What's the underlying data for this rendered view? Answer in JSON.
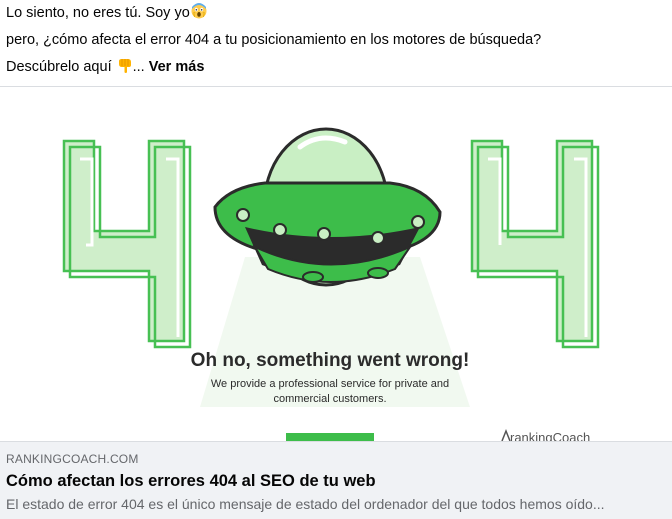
{
  "post": {
    "line1": "Lo siento, no eres tú. Soy yo",
    "line2": "pero, ¿cómo afecta el error 404 a tu posicionamiento en los motores de búsqueda?",
    "line3": "Descúbrelo aquí",
    "ellipsis": "...",
    "see_more": "Ver más"
  },
  "preview": {
    "headline": "Oh no, something went wrong!",
    "body_line1": "We provide a professional service for private and",
    "body_line2": "commercial customers.",
    "logo_text": "rankingCoach"
  },
  "card": {
    "domain": "RANKINGCOACH.COM",
    "title": "Cómo afectan los errores 404 al SEO de tu web",
    "description": "El estado de error 404 es el único mensaje de estado del ordenador del que todos hemos oído..."
  },
  "colors": {
    "accent_green": "#3dbd4a",
    "light_green": "#cfeeca"
  }
}
